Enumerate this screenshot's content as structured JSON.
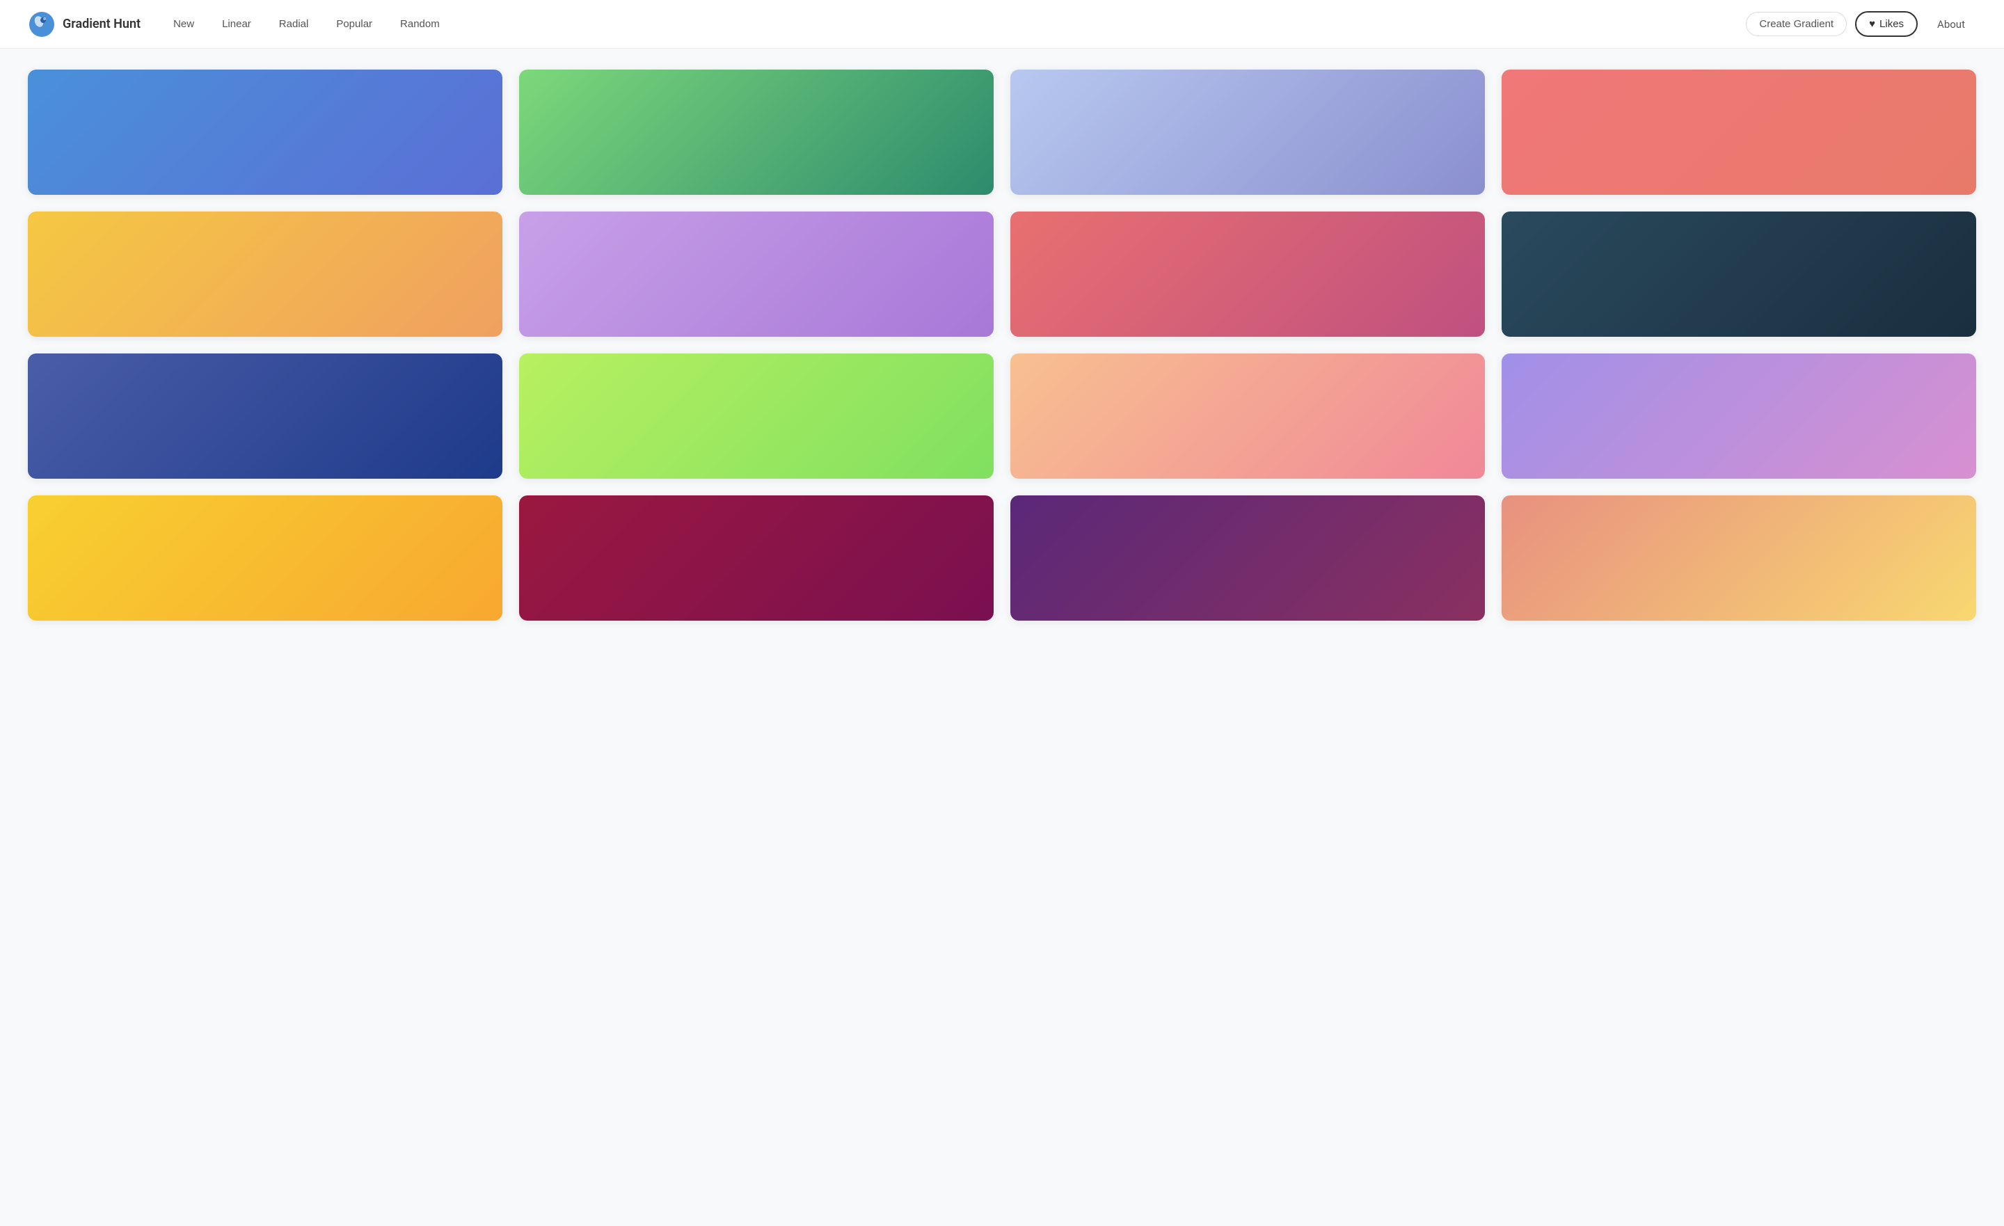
{
  "header": {
    "logo_text": "Gradient Hunt",
    "nav_items": [
      {
        "label": "New",
        "id": "new"
      },
      {
        "label": "Linear",
        "id": "linear"
      },
      {
        "label": "Radial",
        "id": "radial"
      },
      {
        "label": "Popular",
        "id": "popular"
      },
      {
        "label": "Random",
        "id": "random"
      }
    ],
    "create_btn_label": "Create Gradient",
    "likes_btn_label": "Likes",
    "about_label": "About",
    "heart_icon": "♥"
  },
  "gradients": [
    {
      "id": 1,
      "gradient": "linear-gradient(135deg, #4a90d9 0%, #5b6fd6 100%)"
    },
    {
      "id": 2,
      "gradient": "linear-gradient(135deg, #7dd87a 0%, #2d8b6e 100%)"
    },
    {
      "id": 3,
      "gradient": "linear-gradient(135deg, #b8c8f0 0%, #8a8fce 100%)"
    },
    {
      "id": 4,
      "gradient": "linear-gradient(135deg, #f07878 0%, #e87a6a 100%)"
    },
    {
      "id": 5,
      "gradient": "linear-gradient(135deg, #f5c842 0%, #f0a060 100%)"
    },
    {
      "id": 6,
      "gradient": "linear-gradient(135deg, #c8a0e8 0%, #a878d8 100%)"
    },
    {
      "id": 7,
      "gradient": "linear-gradient(135deg, #e87070 0%, #c05080 100%)"
    },
    {
      "id": 8,
      "gradient": "linear-gradient(135deg, #2a4a5e 0%, #1a2e3e 100%)"
    },
    {
      "id": 9,
      "gradient": "linear-gradient(135deg, #4a5da8 0%, #1e3a8a 100%)"
    },
    {
      "id": 10,
      "gradient": "linear-gradient(135deg, #b8f060 0%, #80e060 100%)"
    },
    {
      "id": 11,
      "gradient": "linear-gradient(135deg, #f8c090 0%, #f08898 100%)"
    },
    {
      "id": 12,
      "gradient": "linear-gradient(135deg, #a090e8 0%, #d890d0 100%)"
    },
    {
      "id": 13,
      "gradient": "linear-gradient(135deg, #f8d030 0%, #f8a830 100%)"
    },
    {
      "id": 14,
      "gradient": "linear-gradient(135deg, #9a1840 0%, #7a1050 100%)"
    },
    {
      "id": 15,
      "gradient": "linear-gradient(135deg, #5a2878 0%, #8a3060 100%)"
    },
    {
      "id": 16,
      "gradient": "linear-gradient(135deg, #e89080 0%, #f8d870 100%)"
    }
  ]
}
